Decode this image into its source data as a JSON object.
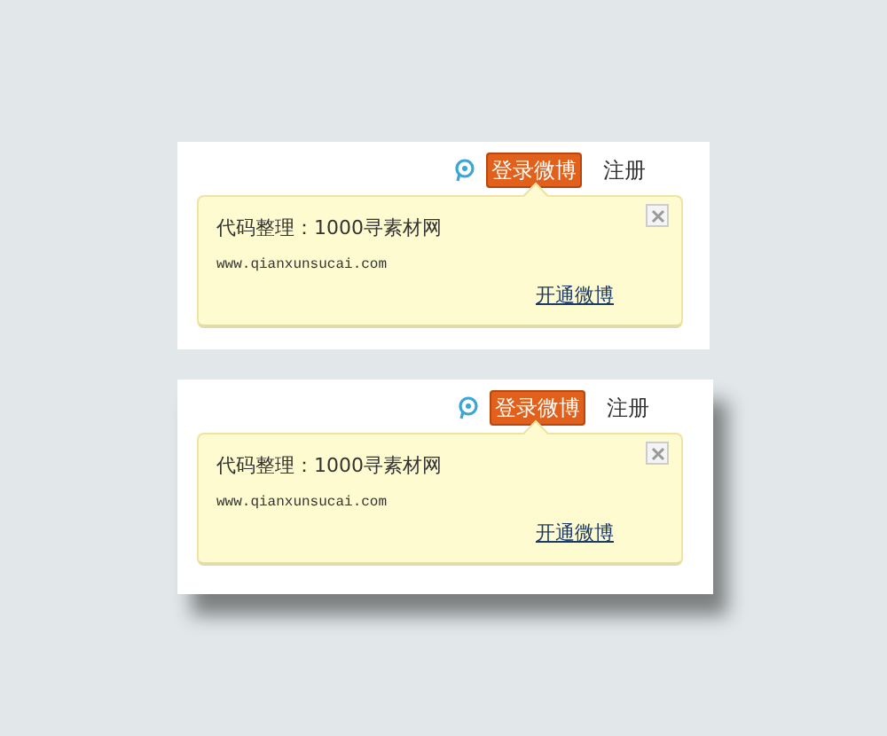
{
  "panels": [
    {
      "shadow": false,
      "login_button": "登录微博",
      "register_link": "注册",
      "tip": {
        "title": "代码整理：1000寻素材网",
        "url": "www.qianxunsucai.com",
        "link": "开通微博"
      }
    },
    {
      "shadow": true,
      "login_button": "登录微博",
      "register_link": "注册",
      "tip": {
        "title": "代码整理：1000寻素材网",
        "url": "www.qianxunsucai.com",
        "link": "开通微博"
      }
    }
  ]
}
